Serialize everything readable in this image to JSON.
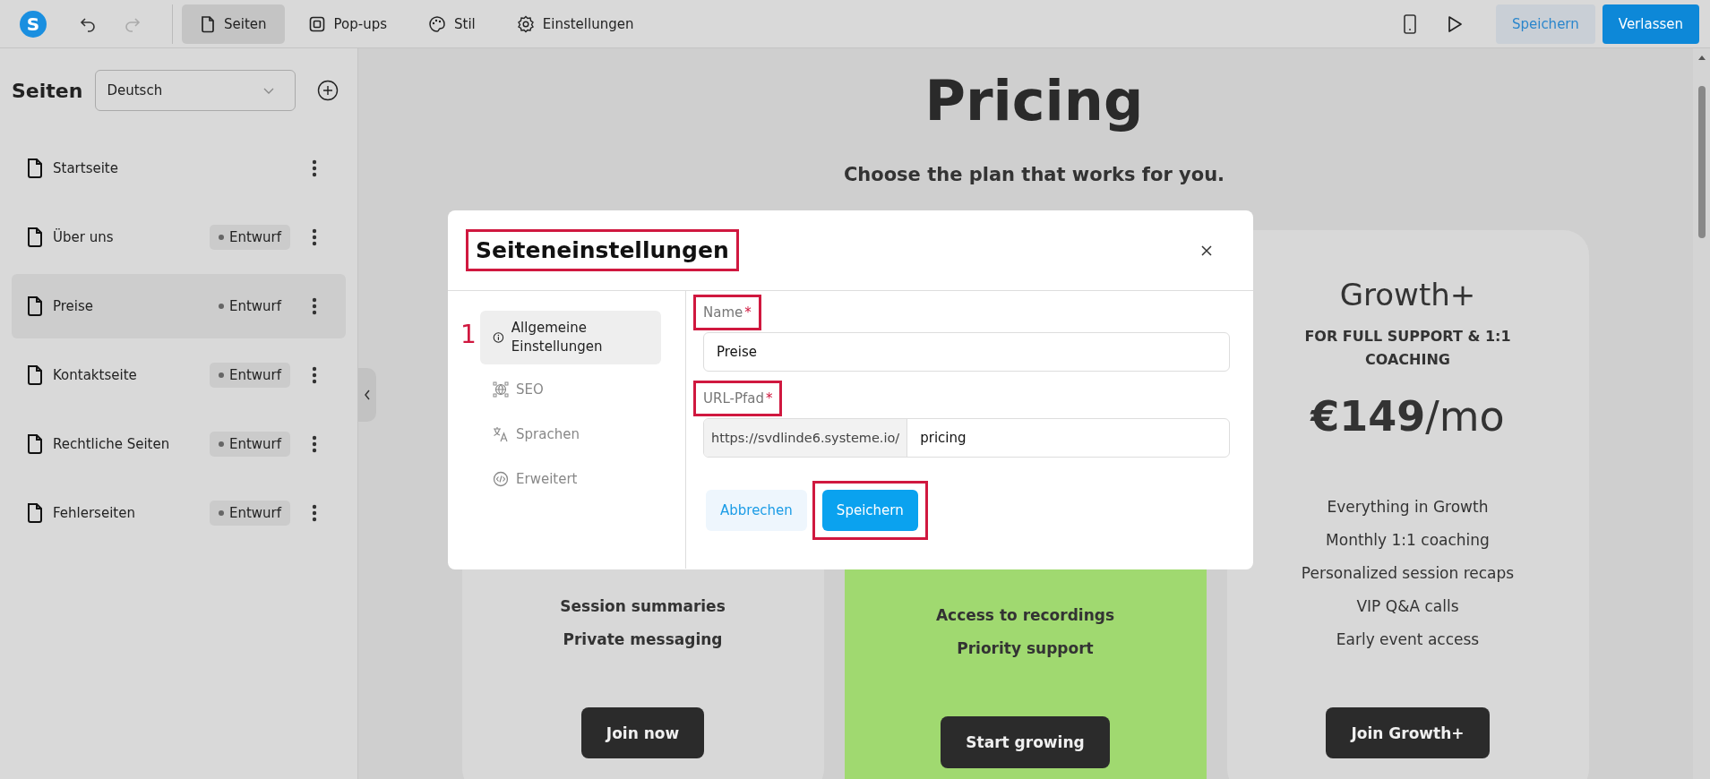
{
  "topbar": {
    "logo": "S",
    "tabs": [
      {
        "label": "Seiten",
        "selected": true
      },
      {
        "label": "Pop-ups",
        "selected": false
      },
      {
        "label": "Stil",
        "selected": false
      },
      {
        "label": "Einstellungen",
        "selected": false
      }
    ],
    "save_button": "Speichern",
    "exit_button": "Verlassen"
  },
  "sidebar": {
    "title": "Seiten",
    "language": "Deutsch",
    "pages": [
      {
        "name": "Startseite",
        "selected": false
      },
      {
        "name": "Über uns",
        "badge": "Entwurf",
        "selected": false
      },
      {
        "name": "Preise",
        "badge": "Entwurf",
        "selected": true
      },
      {
        "name": "Kontaktseite",
        "badge": "Entwurf",
        "selected": false
      },
      {
        "name": "Rechtliche Seiten",
        "badge": "Entwurf",
        "selected": false
      },
      {
        "name": "Fehlerseiten",
        "badge": "Entwurf",
        "selected": false
      }
    ]
  },
  "canvas": {
    "title": "Pricing",
    "subtitle": "Choose the plan that works for you.",
    "cards": [
      {
        "kind": "plain",
        "bold_features": true,
        "features": [
          "Session summaries",
          "Private messaging"
        ],
        "button": "Join now"
      },
      {
        "kind": "featured",
        "bold_features": true,
        "features": [
          "Access to recordings",
          "Priority support"
        ],
        "button": "Start growing"
      },
      {
        "kind": "plain",
        "bold_features": false,
        "name": "Growth+",
        "tagline": "FOR FULL SUPPORT & 1:1 COACHING",
        "price": "€149",
        "period": "/mo",
        "features": [
          "Everything in Growth",
          "Monthly 1:1 coaching",
          "Personalized session recaps",
          "VIP Q&A calls",
          "Early event access"
        ],
        "button": "Join Growth+"
      }
    ]
  },
  "dialog": {
    "title": "Seiteneinstellungen",
    "title_highlighted": true,
    "step_marker": "1",
    "nav": [
      {
        "label": "Allgemeine Einstellungen",
        "selected": true
      },
      {
        "label": "SEO",
        "selected": false
      },
      {
        "label": "Sprachen",
        "selected": false
      },
      {
        "label": "Erweitert",
        "selected": false
      }
    ],
    "fields": [
      {
        "label": "Name",
        "required_mark": "*",
        "highlighted": true,
        "value": "Preise"
      },
      {
        "label": "URL-Pfad",
        "required_mark": "*",
        "highlighted": true,
        "prefix": "https://svdlinde6.systeme.io/",
        "value": "pricing"
      }
    ],
    "cancel_button": "Abbrechen",
    "save_button": {
      "label": "Speichern",
      "highlighted": true
    }
  }
}
